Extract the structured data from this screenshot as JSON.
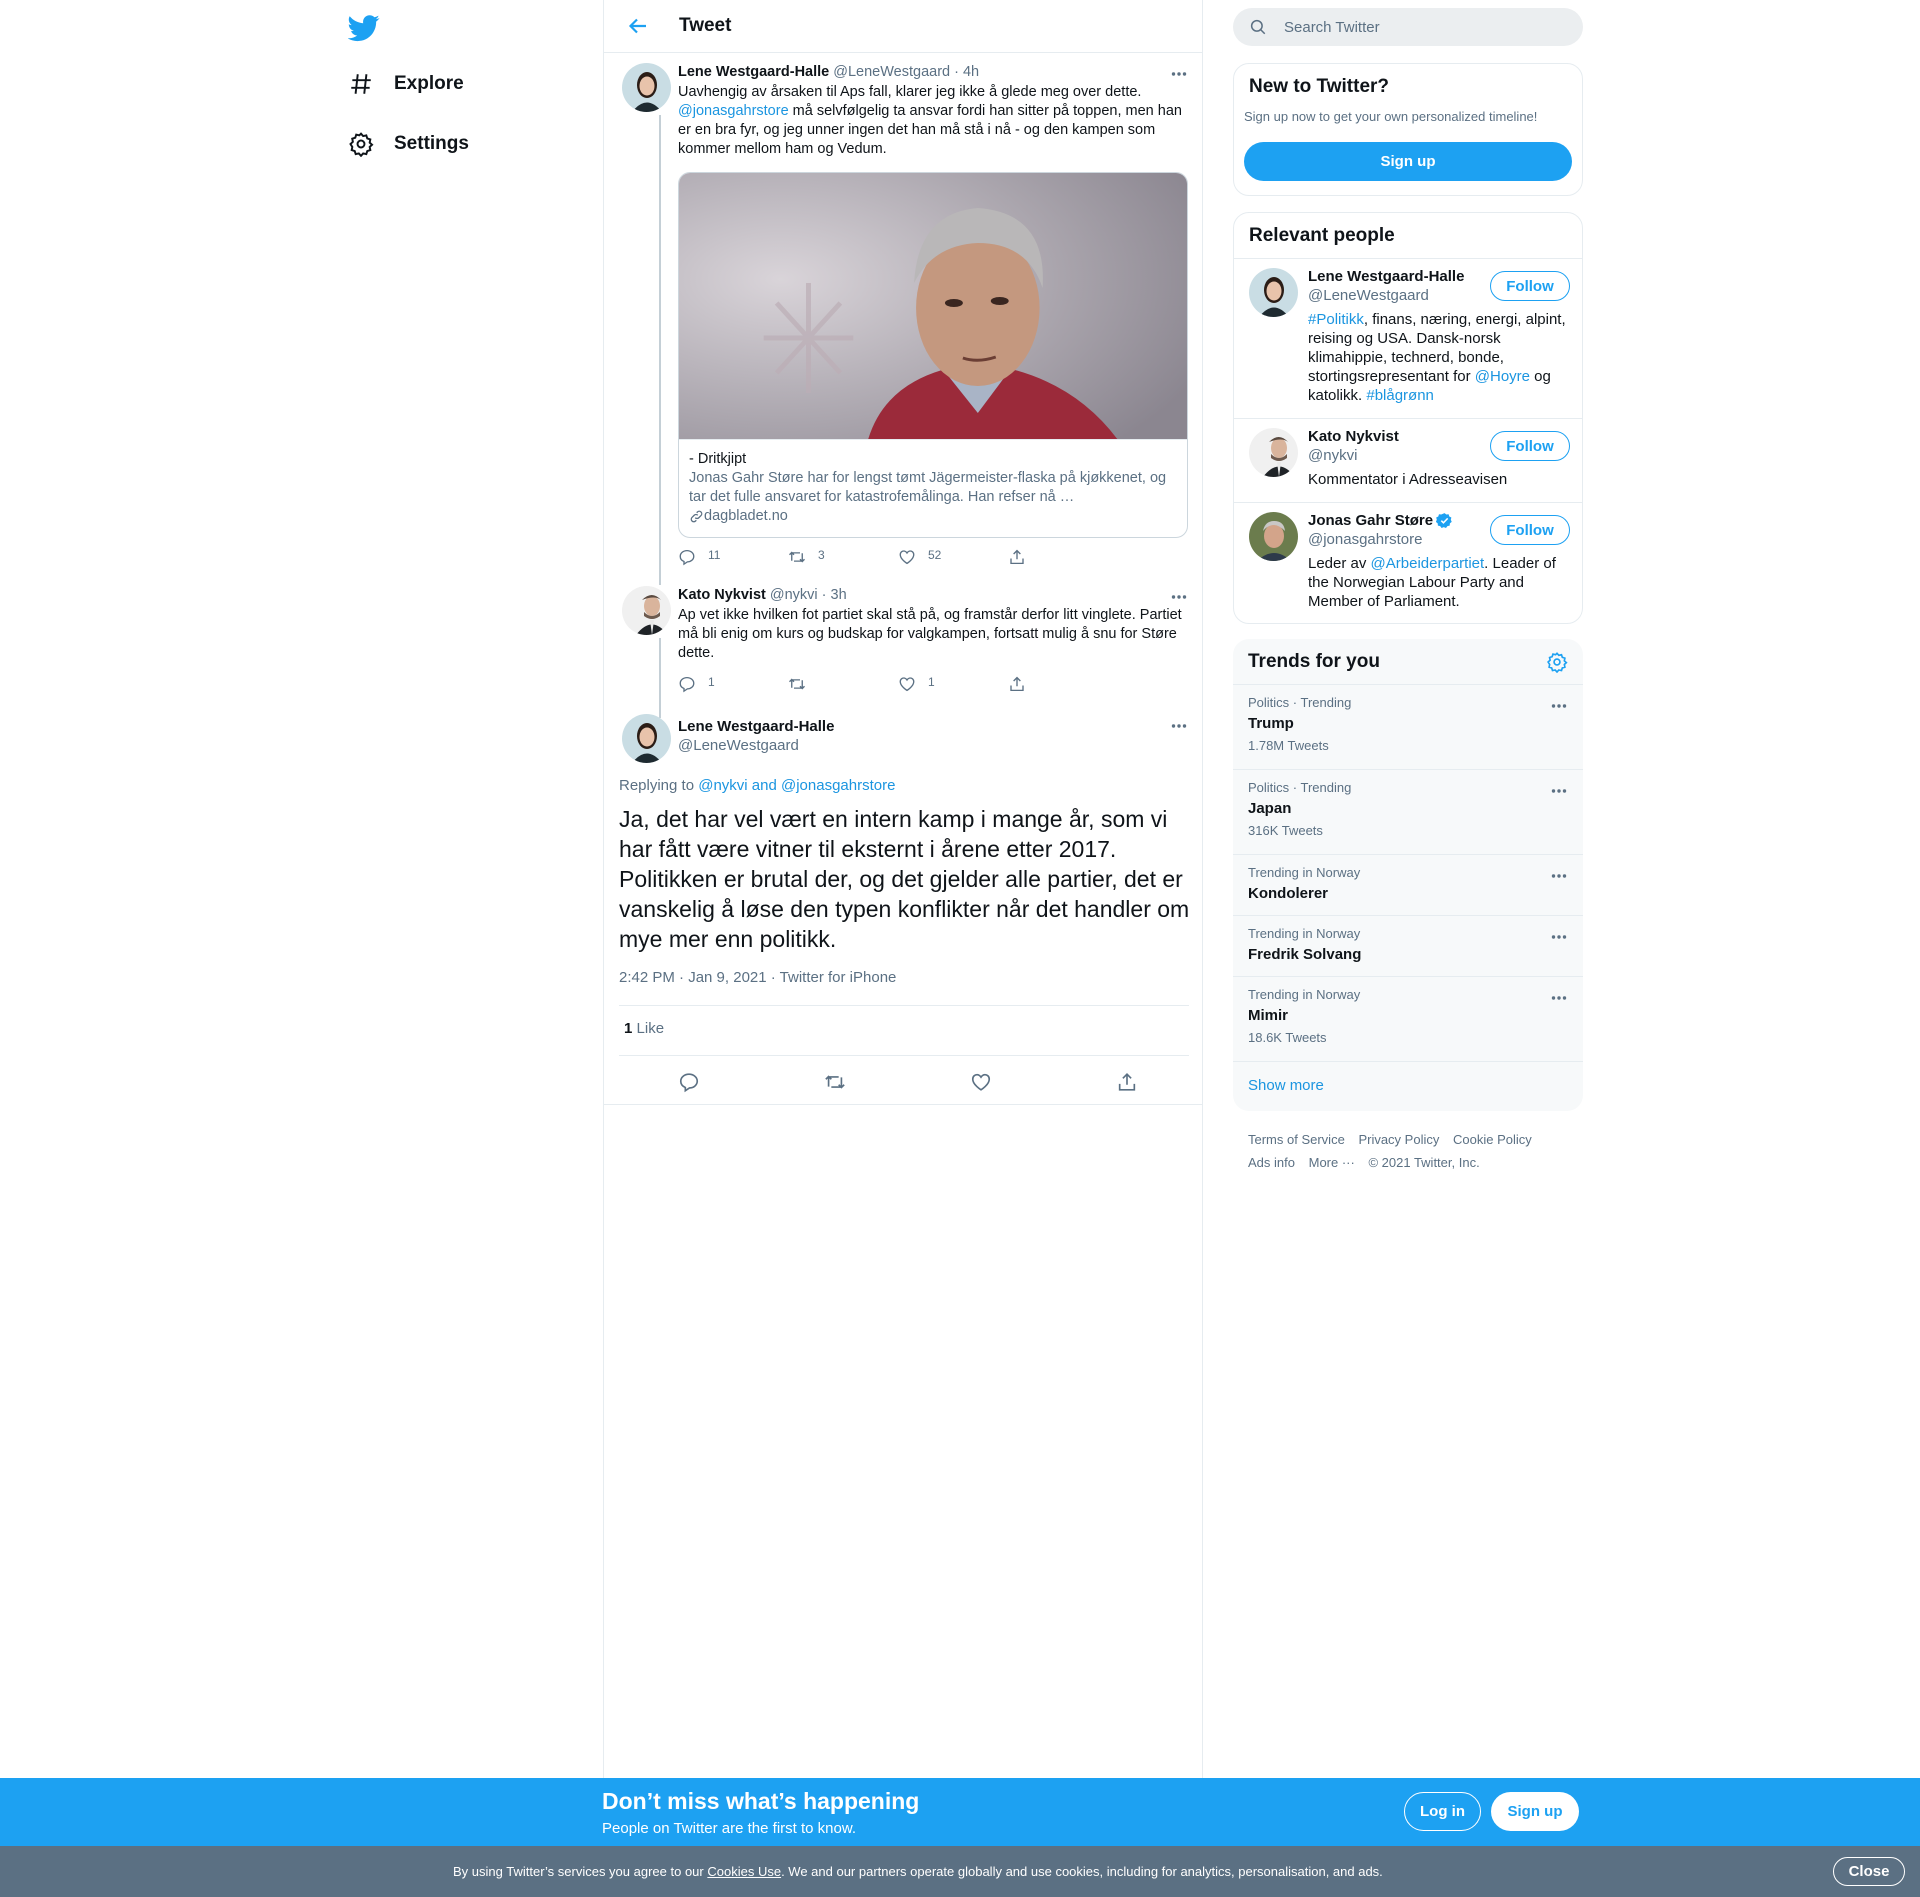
{
  "colors": {
    "accent": "#1da1f2",
    "link": "#1b95e0",
    "muted": "#5b7083",
    "cookie_bg": "#5b7083"
  },
  "nav": {
    "items": [
      {
        "label": "Explore",
        "icon": "hashtag-icon"
      },
      {
        "label": "Settings",
        "icon": "gear-icon"
      }
    ]
  },
  "header": {
    "title": "Tweet"
  },
  "thread": [
    {
      "name": "Lene Westgaard-Halle",
      "handle": "@LeneWestgaard",
      "time": "· 4h",
      "text_1": "Uavhengig av årsaken til Aps fall, klarer jeg ikke å glede meg over dette.",
      "mention": "@jonasgahrstore",
      "text_2": " må selvfølgelig ta ansvar fordi han sitter på toppen, men han er en bra fyr, og jeg unner ingen det han må stå i nå - og den kampen som kommer mellom ham og Vedum.",
      "card": {
        "title": "- Dritkjipt",
        "description": "Jonas Gahr Støre har for lengst tømt Jägermeister-flaska på kjøkkenet, og tar det fulle ansvaret for katastrofemålinga. Han refser nå …",
        "domain": "dagbladet.no"
      },
      "replies": "11",
      "retweets": "3",
      "likes": "52"
    },
    {
      "name": "Kato Nykvist",
      "handle": "@nykvi",
      "time": "· 3h",
      "text": "Ap vet ikke hvilken fot partiet skal stå på, og framstår derfor litt vinglete. Partiet må bli enig om kurs og budskap for valgkampen, fortsatt mulig å snu for Støre dette.",
      "replies": "1",
      "retweets": "",
      "likes": "1"
    }
  ],
  "main_tweet": {
    "name": "Lene Westgaard-Halle",
    "handle": "@LeneWestgaard",
    "replying_label": "Replying to",
    "replying_to": "@nykvi and @jonasgahrstore",
    "text": "Ja, det har vel vært en intern kamp i mange år, som vi har fått være vitner til eksternt i årene etter 2017. Politikken er brutal der, og det gjelder alle partier, det er vanskelig å løse den typen konflikter når det handler om mye mer enn politikk.",
    "time": "2:42 PM · Jan 9, 2021",
    "source": "Twitter for iPhone",
    "like_count": "1",
    "like_label": "Like"
  },
  "search": {
    "placeholder": "Search Twitter"
  },
  "new_to_twitter": {
    "title": "New to Twitter?",
    "subtitle": "Sign up now to get your own personalized timeline!",
    "button": "Sign up"
  },
  "relevant_people": {
    "title": "Relevant people",
    "follow_label": "Follow",
    "people": [
      {
        "name": "Lene Westgaard-Halle",
        "handle": "@LeneWestgaard",
        "bio_tag1": "#Politikk",
        "bio_1": ", finans, næring, energi, alpint, reising og USA. Dansk-norsk klimahippie, technerd, bonde, stortingsrepresentant for ",
        "bio_tag2": "@Hoyre",
        "bio_2": " og katolikk. ",
        "bio_tag3": "#blågrønn"
      },
      {
        "name": "Kato Nykvist",
        "handle": "@nykvi",
        "bio": "Kommentator i Adresseavisen"
      },
      {
        "name": "Jonas Gahr Støre",
        "handle": "@jonasgahrstore",
        "bio_1": "Leder av ",
        "bio_tag": "@Arbeiderpartiet",
        "bio_2": ". Leader of the Norwegian Labour Party and Member of Parliament."
      }
    ]
  },
  "trends": {
    "title": "Trends for you",
    "items": [
      {
        "context": "Politics · Trending",
        "name": "Trump",
        "count": "1.78M Tweets"
      },
      {
        "context": "Politics · Trending",
        "name": "Japan",
        "count": "316K Tweets"
      },
      {
        "context": "Trending in Norway",
        "name": "Kondolerer",
        "count": ""
      },
      {
        "context": "Trending in Norway",
        "name": "Fredrik Solvang",
        "count": ""
      },
      {
        "context": "Trending in Norway",
        "name": "Mimir",
        "count": "18.6K Tweets"
      }
    ],
    "show_more": "Show more"
  },
  "footer": {
    "terms": "Terms of Service",
    "privacy": "Privacy Policy",
    "cookie": "Cookie Policy",
    "ads": "Ads info",
    "more": "More ···",
    "copyright": "© 2021 Twitter, Inc."
  },
  "bottom_banner": {
    "title": "Don’t miss what’s happening",
    "subtitle": "People on Twitter are the first to know.",
    "login": "Log in",
    "signup": "Sign up"
  },
  "cookie_banner": {
    "text_1": "By using Twitter’s services you agree to our ",
    "link": "Cookies Use",
    "text_2": ". We and our partners operate globally and use cookies, including for analytics, personalisation, and ads.",
    "close": "Close"
  }
}
